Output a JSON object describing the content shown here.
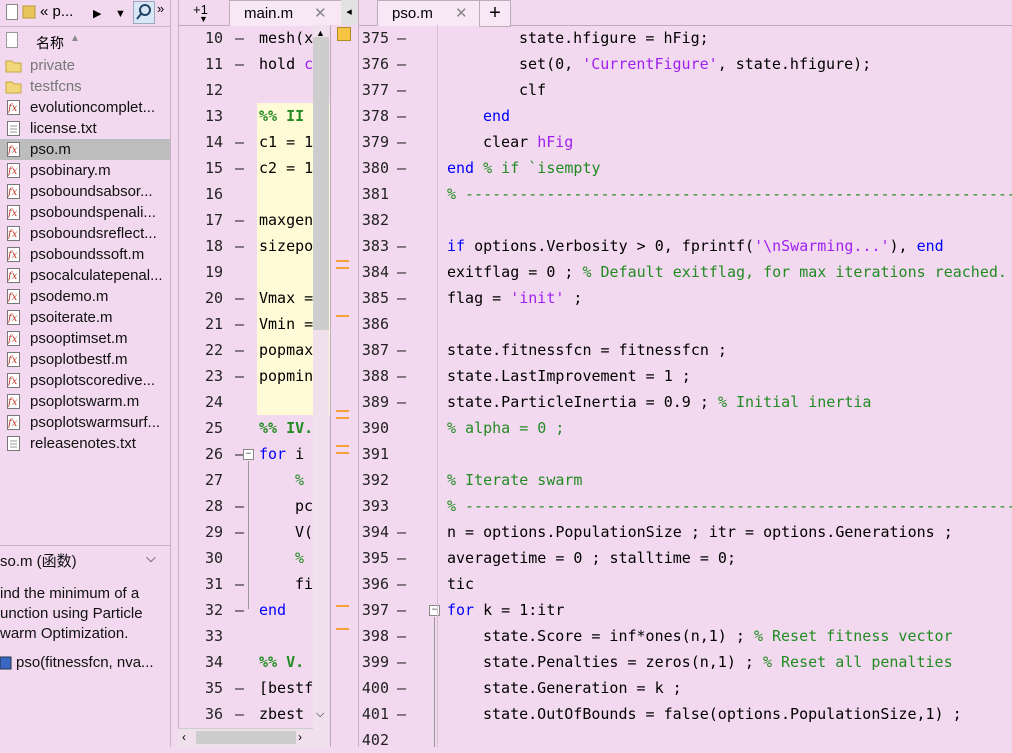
{
  "browser": {
    "addr": "« p...",
    "col_name": "名称",
    "files": [
      {
        "name": "private",
        "type": "folder"
      },
      {
        "name": "testfcns",
        "type": "folder"
      },
      {
        "name": "evolutioncomplet...",
        "type": "fig"
      },
      {
        "name": "license.txt",
        "type": "txt"
      },
      {
        "name": "pso.m",
        "type": "fig",
        "selected": true
      },
      {
        "name": "psobinary.m",
        "type": "fig"
      },
      {
        "name": "psoboundsabsor...",
        "type": "fig"
      },
      {
        "name": "psoboundspenali...",
        "type": "fig"
      },
      {
        "name": "psoboundsreflect...",
        "type": "fig"
      },
      {
        "name": "psoboundssoft.m",
        "type": "fig"
      },
      {
        "name": "psocalculatepenal...",
        "type": "fig"
      },
      {
        "name": "psodemo.m",
        "type": "fig"
      },
      {
        "name": "psoiterate.m",
        "type": "fig"
      },
      {
        "name": "psooptimset.m",
        "type": "fig"
      },
      {
        "name": "psoplotbestf.m",
        "type": "fig"
      },
      {
        "name": "psoplotscoredive...",
        "type": "fig"
      },
      {
        "name": "psoplotswarm.m",
        "type": "fig"
      },
      {
        "name": "psoplotswarmsurf...",
        "type": "fig"
      },
      {
        "name": "releasenotes.txt",
        "type": "txt"
      }
    ],
    "info_title": "so.m (函数)",
    "info_desc": [
      "ind the minimum of a",
      "unction using Particle",
      "warm Optimization."
    ],
    "info_sig": "pso(fitnessfcn, nva..."
  },
  "editor1": {
    "tab_plus": "+1",
    "tab_label": "main.m",
    "lines": [
      {
        "n": "10",
        "dash": true,
        "segs": [
          [
            "mesh(x",
            ""
          ]
        ]
      },
      {
        "n": "11",
        "dash": true,
        "segs": [
          [
            "hold ",
            ""
          ],
          [
            "c",
            "str"
          ]
        ]
      },
      {
        "n": "12",
        "dash": false,
        "segs": []
      },
      {
        "n": "13",
        "dash": false,
        "cell": true,
        "segs": [
          [
            "%% II",
            "sec"
          ]
        ]
      },
      {
        "n": "14",
        "dash": true,
        "cell": true,
        "segs": [
          [
            "c1 = 1",
            ""
          ]
        ]
      },
      {
        "n": "15",
        "dash": true,
        "cell": true,
        "segs": [
          [
            "c2 = 1",
            ""
          ]
        ]
      },
      {
        "n": "16",
        "dash": false,
        "cell": true,
        "segs": []
      },
      {
        "n": "17",
        "dash": true,
        "cell": true,
        "segs": [
          [
            "maxgen",
            ""
          ]
        ]
      },
      {
        "n": "18",
        "dash": true,
        "cell": true,
        "segs": [
          [
            "sizepo",
            ""
          ]
        ]
      },
      {
        "n": "19",
        "dash": false,
        "cell": true,
        "segs": []
      },
      {
        "n": "20",
        "dash": true,
        "cell": true,
        "segs": [
          [
            "Vmax =",
            ""
          ]
        ]
      },
      {
        "n": "21",
        "dash": true,
        "cell": true,
        "segs": [
          [
            "Vmin =",
            ""
          ]
        ]
      },
      {
        "n": "22",
        "dash": true,
        "cell": true,
        "segs": [
          [
            "popmax",
            ""
          ]
        ]
      },
      {
        "n": "23",
        "dash": true,
        "cell": true,
        "segs": [
          [
            "popmin",
            ""
          ]
        ]
      },
      {
        "n": "24",
        "dash": false,
        "cell": true,
        "segs": []
      },
      {
        "n": "25",
        "dash": false,
        "segs": [
          [
            "%% IV.",
            "sec"
          ]
        ]
      },
      {
        "n": "26",
        "dash": true,
        "fold": true,
        "segs": [
          [
            "for ",
            "kw"
          ],
          [
            "i",
            ""
          ]
        ]
      },
      {
        "n": "27",
        "dash": false,
        "indent": true,
        "segs": [
          [
            "%",
            "cm"
          ]
        ]
      },
      {
        "n": "28",
        "dash": true,
        "indent": true,
        "segs": [
          [
            "pc",
            ""
          ]
        ]
      },
      {
        "n": "29",
        "dash": true,
        "indent": true,
        "segs": [
          [
            "V(",
            ""
          ]
        ]
      },
      {
        "n": "30",
        "dash": false,
        "indent": true,
        "segs": [
          [
            "%",
            "cm"
          ]
        ]
      },
      {
        "n": "31",
        "dash": true,
        "indent": true,
        "segs": [
          [
            "fi",
            ""
          ]
        ]
      },
      {
        "n": "32",
        "dash": true,
        "segs": [
          [
            "end",
            "kw"
          ]
        ]
      },
      {
        "n": "33",
        "dash": false,
        "segs": []
      },
      {
        "n": "34",
        "dash": false,
        "segs": [
          [
            "%% V.",
            "sec"
          ]
        ]
      },
      {
        "n": "35",
        "dash": true,
        "segs": [
          [
            "[bestf",
            ""
          ]
        ]
      },
      {
        "n": "36",
        "dash": true,
        "segs": [
          [
            "zbest ",
            ""
          ]
        ]
      }
    ]
  },
  "editor2": {
    "tab_label": "pso.m",
    "lines": [
      {
        "n": "375",
        "dash": true,
        "ind": 2,
        "segs": [
          [
            "state.hfigure = hFig;",
            ""
          ]
        ]
      },
      {
        "n": "376",
        "dash": true,
        "ind": 2,
        "segs": [
          [
            "set(0, ",
            ""
          ],
          [
            "'CurrentFigure'",
            "str"
          ],
          [
            ", state.hfigure);",
            ""
          ]
        ]
      },
      {
        "n": "377",
        "dash": true,
        "ind": 2,
        "segs": [
          [
            "clf",
            ""
          ]
        ]
      },
      {
        "n": "378",
        "dash": true,
        "ind": 1,
        "segs": [
          [
            "end",
            "kw"
          ]
        ]
      },
      {
        "n": "379",
        "dash": true,
        "ind": 1,
        "segs": [
          [
            "clear ",
            ""
          ],
          [
            "hFig",
            "str"
          ]
        ]
      },
      {
        "n": "380",
        "dash": true,
        "ind": 0,
        "segs": [
          [
            "end",
            "kw"
          ],
          [
            " % if `isempty",
            "cm"
          ]
        ]
      },
      {
        "n": "381",
        "dash": false,
        "ind": 0,
        "segs": [
          [
            "% ------------------------------------------------------------------",
            "cm"
          ]
        ]
      },
      {
        "n": "382",
        "dash": false,
        "ind": 0,
        "segs": []
      },
      {
        "n": "383",
        "dash": true,
        "ind": 0,
        "segs": [
          [
            "if ",
            "kw"
          ],
          [
            "options.Verbosity > 0, fprintf(",
            ""
          ],
          [
            "'\\nSwarming...'",
            "str"
          ],
          [
            "), ",
            ""
          ],
          [
            "end",
            "kw"
          ]
        ]
      },
      {
        "n": "384",
        "dash": true,
        "ind": 0,
        "segs": [
          [
            "exitflag = 0 ; ",
            ""
          ],
          [
            "% Default exitflag, for max iterations reached.",
            "cm"
          ]
        ]
      },
      {
        "n": "385",
        "dash": true,
        "ind": 0,
        "segs": [
          [
            "flag = ",
            ""
          ],
          [
            "'init'",
            "str"
          ],
          [
            " ;",
            ""
          ]
        ]
      },
      {
        "n": "386",
        "dash": false,
        "ind": 0,
        "segs": []
      },
      {
        "n": "387",
        "dash": true,
        "ind": 0,
        "segs": [
          [
            "state.fitnessfcn = fitnessfcn ;",
            ""
          ]
        ]
      },
      {
        "n": "388",
        "dash": true,
        "ind": 0,
        "segs": [
          [
            "state.LastImprovement = 1 ;",
            ""
          ]
        ]
      },
      {
        "n": "389",
        "dash": true,
        "ind": 0,
        "segs": [
          [
            "state.ParticleInertia = 0.9 ; ",
            ""
          ],
          [
            "% Initial inertia",
            "cm"
          ]
        ]
      },
      {
        "n": "390",
        "dash": false,
        "ind": 0,
        "segs": [
          [
            "% alpha = 0 ;",
            "cm"
          ]
        ]
      },
      {
        "n": "391",
        "dash": false,
        "ind": 0,
        "segs": []
      },
      {
        "n": "392",
        "dash": false,
        "ind": 0,
        "segs": [
          [
            "% Iterate swarm",
            "cm"
          ]
        ]
      },
      {
        "n": "393",
        "dash": false,
        "ind": 0,
        "segs": [
          [
            "% ------------------------------------------------------------------",
            "cm"
          ]
        ]
      },
      {
        "n": "394",
        "dash": true,
        "ind": 0,
        "segs": [
          [
            "n = options.PopulationSize ; itr = options.Generations ;",
            ""
          ]
        ]
      },
      {
        "n": "395",
        "dash": true,
        "ind": 0,
        "segs": [
          [
            "averagetime = 0 ; stalltime = 0;",
            ""
          ]
        ]
      },
      {
        "n": "396",
        "dash": true,
        "ind": 0,
        "segs": [
          [
            "tic",
            ""
          ]
        ]
      },
      {
        "n": "397",
        "dash": true,
        "ind": 0,
        "fold": true,
        "segs": [
          [
            "for ",
            "kw"
          ],
          [
            "k = 1:itr",
            ""
          ]
        ]
      },
      {
        "n": "398",
        "dash": true,
        "ind": 1,
        "segs": [
          [
            "state.Score = inf*ones(n,1) ; ",
            ""
          ],
          [
            "% Reset fitness vector",
            "cm"
          ]
        ]
      },
      {
        "n": "399",
        "dash": true,
        "ind": 1,
        "segs": [
          [
            "state.Penalties = zeros(n,1) ; ",
            ""
          ],
          [
            "% Reset all penalties",
            "cm"
          ]
        ]
      },
      {
        "n": "400",
        "dash": true,
        "ind": 1,
        "segs": [
          [
            "state.Generation = k ;",
            ""
          ]
        ]
      },
      {
        "n": "401",
        "dash": true,
        "ind": 1,
        "segs": [
          [
            "state.OutOfBounds = false(options.PopulationSize,1) ;",
            ""
          ]
        ]
      },
      {
        "n": "402",
        "dash": false,
        "ind": 0,
        "segs": []
      }
    ]
  },
  "colors": {
    "background": "#f2d9ef",
    "keyword": "#0000ff",
    "string": "#a020f0",
    "comment": "#228b22",
    "warning_mark": "#f5a13a"
  }
}
